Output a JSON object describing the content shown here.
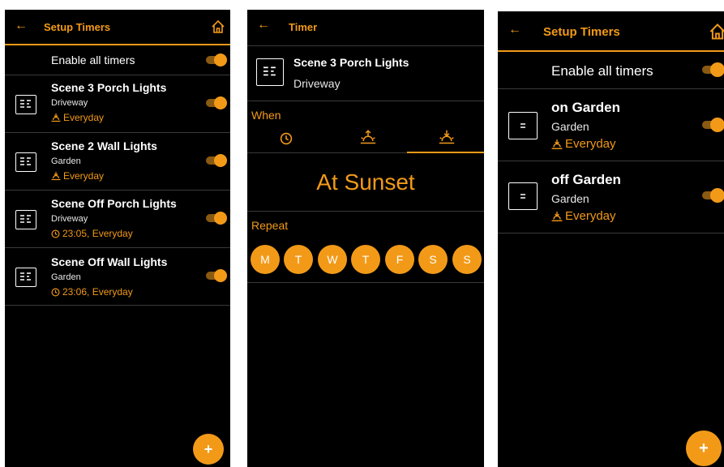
{
  "colors": {
    "accent": "#f29a18",
    "background": "#000000"
  },
  "screen1": {
    "title": "Setup Timers",
    "back_icon": "arrow-left-icon",
    "home_icon": "home-icon",
    "enable_all_label": "Enable all timers",
    "enable_all_on": true,
    "timers": [
      {
        "name": "Scene 3 Porch Lights",
        "room": "Driveway",
        "schedule": "Everyday",
        "schedule_icon": "sunset-icon",
        "on": true
      },
      {
        "name": "Scene 2 Wall Lights",
        "room": "Garden",
        "schedule": "Everyday",
        "schedule_icon": "sunset-icon",
        "on": true
      },
      {
        "name": "Scene Off Porch Lights",
        "room": "Driveway",
        "schedule": "23:05, Everyday",
        "schedule_icon": "clock-icon",
        "on": true
      },
      {
        "name": "Scene Off Wall Lights",
        "room": "Garden",
        "schedule": "23:06, Everyday",
        "schedule_icon": "clock-icon",
        "on": true
      }
    ],
    "fab_label": "+"
  },
  "screen2": {
    "title": "Timer",
    "back_icon": "arrow-left-icon",
    "scene_name": "Scene 3 Porch Lights",
    "scene_room": "Driveway",
    "when_label": "When",
    "when_tabs": [
      "clock-icon",
      "sunrise-icon",
      "sunset-icon"
    ],
    "when_selected": "sunset-icon",
    "big_label": "At Sunset",
    "repeat_label": "Repeat",
    "days": [
      "M",
      "T",
      "W",
      "T",
      "F",
      "S",
      "S"
    ]
  },
  "screen3": {
    "title": "Setup Timers",
    "back_icon": "arrow-left-icon",
    "home_icon": "home-icon",
    "enable_all_label": "Enable all timers",
    "enable_all_on": true,
    "timers": [
      {
        "name": "on Garden",
        "room": "Garden",
        "schedule": "Everyday",
        "schedule_icon": "sunset-icon",
        "on": true
      },
      {
        "name": "off Garden",
        "room": "Garden",
        "schedule": "Everyday",
        "schedule_icon": "sunset-icon",
        "on": true
      }
    ],
    "fab_label": "+"
  }
}
